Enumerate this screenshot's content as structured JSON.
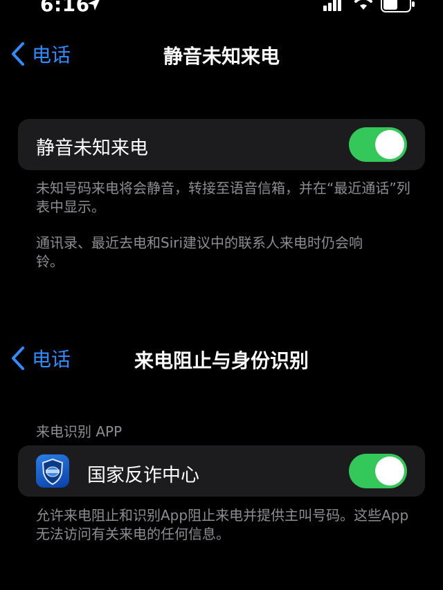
{
  "status_bar": {
    "time": "6:16"
  },
  "screen1": {
    "back_label": "电话",
    "title": "静音未知来电",
    "toggle_row": {
      "label": "静音未知来电",
      "enabled": true
    },
    "footnote_1": "未知号码来电将会静音，转接至语音信箱，并在“最近通话”列表中显示。",
    "footnote_2": "通讯录、最近去电和Siri建议中的联系人来电时仍会响铃。"
  },
  "screen2": {
    "back_label": "电话",
    "title": "来电阻止与身份识别",
    "section_header": "来电识别 APP",
    "app_row": {
      "label": "国家反诈中心",
      "enabled": true
    },
    "footnote": "允许来电阻止和识别App阻止来电并提供主叫号码。这些App无法访问有关来电的任何信息。"
  },
  "colors": {
    "accent": "#2f8cff",
    "toggle_on": "#34c759",
    "cell_bg": "#1c1c1e",
    "secondary_text": "#8d8d93"
  }
}
